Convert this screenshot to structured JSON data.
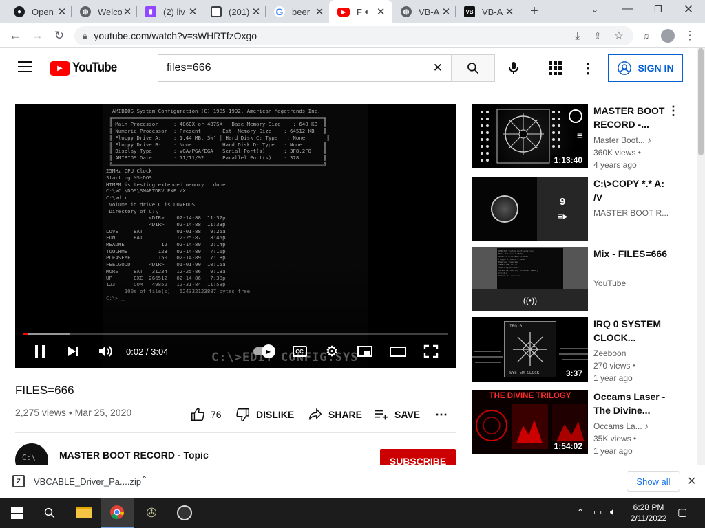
{
  "browser": {
    "tabs": [
      {
        "title": "Open",
        "icon": "github-icon"
      },
      {
        "title": "Welco",
        "icon": "globe-icon"
      },
      {
        "title": "(2) liv",
        "icon": "twitch-icon"
      },
      {
        "title": "(201)",
        "icon": "page-icon"
      },
      {
        "title": "beer",
        "icon": "google-icon"
      },
      {
        "title": "F",
        "icon": "youtube-icon",
        "active": true
      },
      {
        "title": "VB-A",
        "icon": "globe-icon"
      },
      {
        "title": "VB-A",
        "icon": "vb-icon"
      }
    ],
    "url": "youtube.com/watch?v=sWHRTfzOxgo"
  },
  "youtube": {
    "logo_text": "YouTube",
    "search_value": "files=666",
    "sign_in": "SIGN IN"
  },
  "player": {
    "time": "0:02 / 3:04",
    "progress_fraction": 0.011,
    "buffered_fraction": 0.11,
    "overlay_text": "C:\\>EDIT CONFIG.SYS",
    "screen_lines": [
      "  AMIBIOS System Configuration (C) 1985-1992, American Megatrends Inc.",
      " ╔══════════════════════════════════╤══════════════════════════════════╗",
      " ║ Main Processor     : 486DX or 487SX │ Base Memory Size    : 640 KB  ║",
      " ║ Numeric Processor  : Present     │ Ext. Memory Size    : 64512 KB   ║",
      " ║ Floppy Drive A:    : 1.44 MB, 3½\" │ Hard Disk C: Type   : None       ║",
      " ║ Floppy Drive B:    : None        │ Hard Disk D: Type   : None       ║",
      " ║ Display Type       : VGA/PGA/EGA │ Serial Port(s)      : 3F8,2F8    ║",
      " ║ AMIBIOS Date       : 11/11/92    │ Parallel Port(s)    : 378        ║",
      " ╚══════════════════════════════════╧══════════════════════════════════╝",
      "25MHz CPU Clock",
      "Starting MS-DOS...",
      "",
      "HIMEM is testing extended memory...done.",
      "",
      "C:\\>C:\\DOS\\SMARTDRV.EXE /X",
      "C:\\>dir",
      "",
      " Volume in drive C is LOVEDOS",
      " Directory of C:\\",
      "",
      "              <DIR>    02-14-88  11:32p",
      "              <DIR>    02-14-88  11:33p",
      "LOVE     BAT           01-01-88   9:25a",
      "FUN      BAT           12-25-87   8:45p",
      "README            12   02-14-89   2:14p",
      "TOUCHME          123   02-14-89   7:16p",
      "PLEASEME         150   02-14-89   7:18p",
      "FEELGOOD      <DIR>    01-01-90  10:15a",
      "MORE     BAT   31234   12-25-86   9:13a",
      "UP       EXE  266512   02-14-86   7:38p",
      "123      COM   49852   12-31-84  11:53p",
      "      100s of file(s)   524332123887 bytes free",
      "",
      "C:\\> _"
    ]
  },
  "video": {
    "title": "FILES=666",
    "views": "2,275 views",
    "date": "Mar 25, 2020",
    "likes": "76",
    "dislike": "DISLIKE",
    "share": "SHARE",
    "save": "SAVE"
  },
  "channel": {
    "name": "MASTER BOOT RECORD - Topic",
    "subscribe": "SUBSCRIBE"
  },
  "recommendations": [
    {
      "title": "MASTER BOOT RECORD -...",
      "channel": "Master Boot...",
      "views": "360K views •",
      "age": "4 years ago",
      "duration": "1:13:40"
    },
    {
      "title": "C:\\>COPY *.* A: /V",
      "channel": "MASTER BOOT R...",
      "playlist_count": "9"
    },
    {
      "title": "Mix - FILES=666",
      "channel": "YouTube"
    },
    {
      "title": "IRQ 0 SYSTEM CLOCK...",
      "channel": "Zeeboon",
      "views": "270 views •",
      "age": "1 year ago",
      "duration": "3:37",
      "thumb_text": "IRQ 0",
      "thumb_text2": "SYSTEM CLOCK"
    },
    {
      "title": "Occams Laser - The Divine...",
      "channel": "Occams La...",
      "views": "35K views •",
      "age": "1 year ago",
      "duration": "1:54:02",
      "thumb_text": "THE DIVINE TRILOGY"
    }
  ],
  "download_bar": {
    "file": "VBCABLE_Driver_Pa....zip",
    "show_all": "Show all"
  },
  "taskbar": {
    "time": "6:28 PM",
    "date": "2/11/2022"
  },
  "colors": {
    "yt_red": "#ff0000",
    "subscribe_red": "#cc0000",
    "link_blue": "#065fd4"
  }
}
